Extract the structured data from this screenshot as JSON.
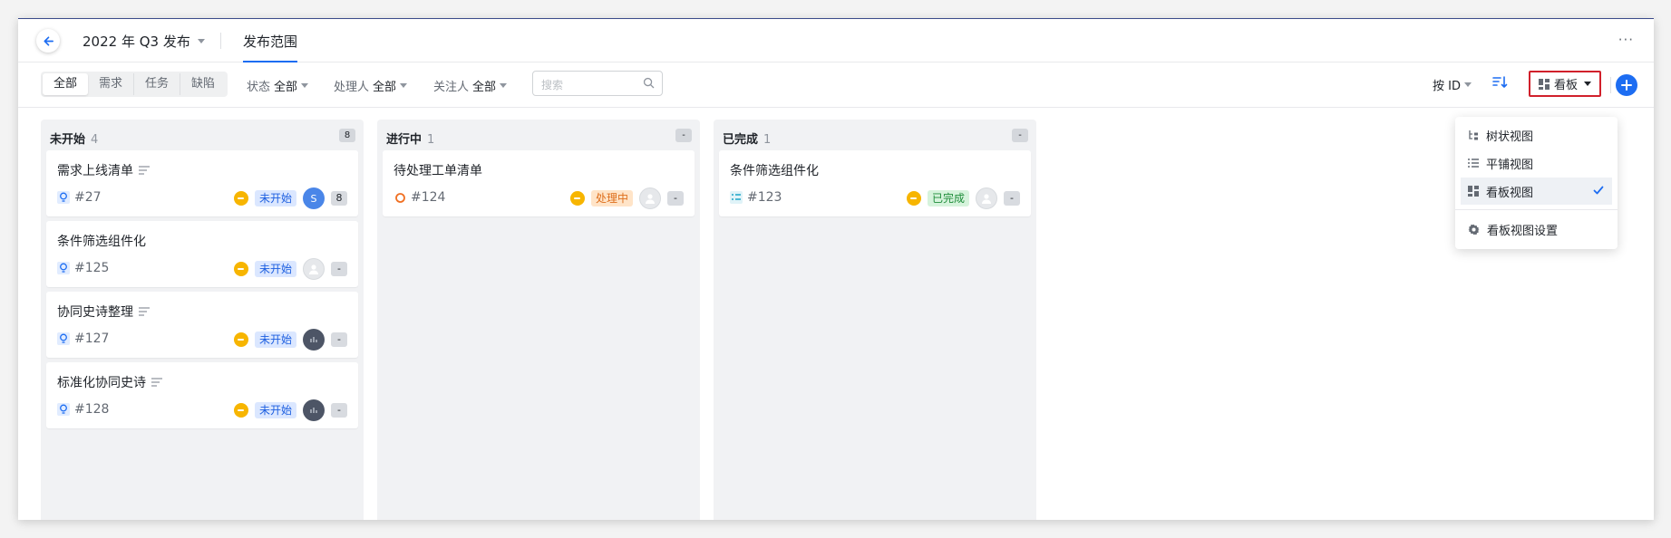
{
  "header": {
    "release_name": "2022 年 Q3 发布",
    "tab_scope": "发布范围",
    "more": "···"
  },
  "toolbar": {
    "segments": [
      "全部",
      "需求",
      "任务",
      "缺陷"
    ],
    "filters": [
      {
        "label": "状态",
        "value": "全部"
      },
      {
        "label": "处理人",
        "value": "全部"
      },
      {
        "label": "关注人",
        "value": "全部"
      }
    ],
    "search_placeholder": "搜索",
    "sort_label": "按 ID",
    "view_label": "看板"
  },
  "view_menu": {
    "items": [
      "树状视图",
      "平铺视图",
      "看板视图"
    ],
    "selected": "看板视图",
    "settings": "看板视图设置"
  },
  "columns": [
    {
      "title": "未开始",
      "count": "4",
      "badge": "8",
      "cards": [
        {
          "title": "需求上线清单",
          "id": "#27",
          "status": "未开始",
          "avatar": "S",
          "extra": "8"
        },
        {
          "title": "条件筛选组件化",
          "id": "#125",
          "status": "未开始",
          "avatar": "",
          "extra": "-"
        },
        {
          "title": "协同史诗整理",
          "id": "#127",
          "status": "未开始",
          "avatar": "",
          "extra": "-"
        },
        {
          "title": "标准化协同史诗",
          "id": "#128",
          "status": "未开始",
          "avatar": "",
          "extra": "-"
        }
      ]
    },
    {
      "title": "进行中",
      "count": "1",
      "badge": "-",
      "cards": [
        {
          "title": "待处理工单清单",
          "id": "#124",
          "status": "处理中",
          "avatar": "",
          "extra": "-"
        }
      ]
    },
    {
      "title": "已完成",
      "count": "1",
      "badge": "-",
      "cards": [
        {
          "title": "条件筛选组件化",
          "id": "#123",
          "status": "已完成",
          "avatar": "",
          "extra": "-"
        }
      ]
    }
  ],
  "colors": {
    "accent": "#1d6df2",
    "highlight_box": "#d1202b",
    "priority": "#f7b500"
  }
}
